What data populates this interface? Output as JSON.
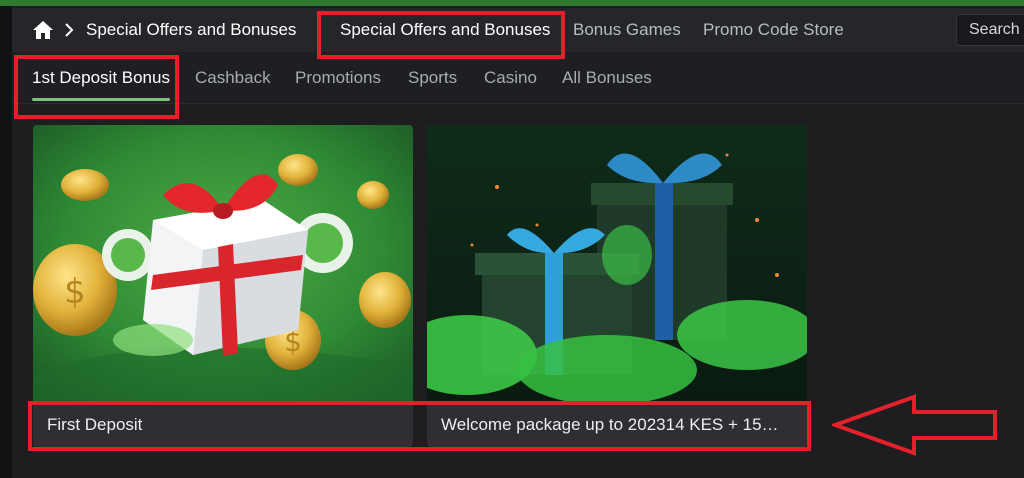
{
  "breadcrumb": {
    "current": "Special Offers and Bonuses"
  },
  "top_nav": {
    "tabs": [
      "Special Offers and Bonuses",
      "Bonus Games",
      "Promo Code Store"
    ],
    "search_label": "Search"
  },
  "sub_nav": {
    "tabs": [
      "1st Deposit Bonus",
      "Cashback",
      "Promotions",
      "Sports",
      "Casino",
      "All Bonuses"
    ]
  },
  "cards": [
    {
      "title": "First Deposit"
    },
    {
      "title": "Welcome package up to 202314 KES + 15…"
    }
  ],
  "colors": {
    "highlight": "#e4212a",
    "active_underline": "#7bc27b",
    "accent_green": "#2f7a2f"
  }
}
